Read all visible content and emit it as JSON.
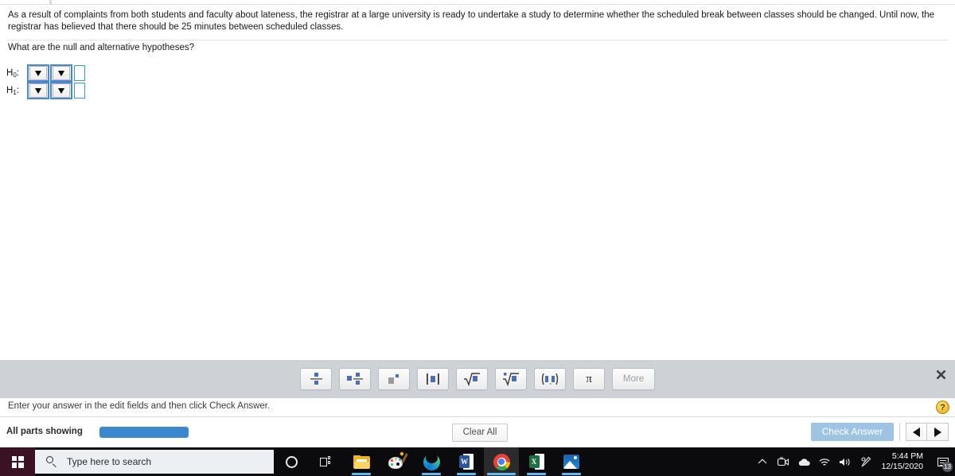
{
  "question": {
    "body": "As a result of complaints from both students and faculty about lateness, the registrar at a large university is ready to undertake a study to determine whether the scheduled break between classes should be changed. Until now, the registrar has believed that there should be 25 minutes between scheduled classes.",
    "prompt": "What are the null and alternative hypotheses?"
  },
  "hypotheses": [
    {
      "label": "H",
      "subscript": "0",
      "colon": ":",
      "dropdown1": "",
      "dropdown2": "",
      "value": ""
    },
    {
      "label": "H",
      "subscript": "1",
      "colon": ":",
      "dropdown1": "",
      "dropdown2": "",
      "value": ""
    }
  ],
  "palette": {
    "buttons": [
      {
        "name": "fraction-stacked",
        "label": ""
      },
      {
        "name": "mixed-fraction",
        "label": ""
      },
      {
        "name": "superscript",
        "label": ""
      },
      {
        "name": "absolute-value",
        "label": ""
      },
      {
        "name": "square-root",
        "label": ""
      },
      {
        "name": "nth-root",
        "label": ""
      },
      {
        "name": "interval-notation",
        "label": ""
      },
      {
        "name": "pi-symbol",
        "label": "π"
      }
    ],
    "more_label": "More",
    "close_label": "✖"
  },
  "instruction": {
    "text": "Enter your answer in the edit fields and then click Check Answer.",
    "help_label": "?"
  },
  "footer": {
    "parts_label": "All parts showing",
    "progress_percent": 100,
    "clear_all_label": "Clear All",
    "check_answer_label": "Check Answer",
    "prev_label": "◀",
    "next_label": "▶"
  },
  "taskbar": {
    "search_placeholder": "Type here to search",
    "items": [
      {
        "name": "cortana-icon"
      },
      {
        "name": "task-view-icon"
      },
      {
        "name": "file-explorer-icon"
      },
      {
        "name": "paint-3d-icon"
      },
      {
        "name": "microsoft-edge-icon"
      },
      {
        "name": "microsoft-word-icon",
        "letter": "W"
      },
      {
        "name": "google-chrome-icon"
      },
      {
        "name": "microsoft-excel-icon",
        "letter": "X"
      },
      {
        "name": "photos-icon"
      }
    ],
    "tray": {
      "show_hidden_label": "∧",
      "meet-now_label": "",
      "onedrive_label": "",
      "network_label": "",
      "volume_label": "",
      "pen_label": "",
      "time": "5:44 PM",
      "date": "12/15/2020",
      "notification_count": "13"
    }
  },
  "colors": {
    "accent_blue": "#3b87cd",
    "palette_bg": "#ced1d6",
    "check_answer_bg": "#9fc4e3",
    "glyph_blue": "#4a6fb5",
    "field_border": "#4a86d8"
  }
}
